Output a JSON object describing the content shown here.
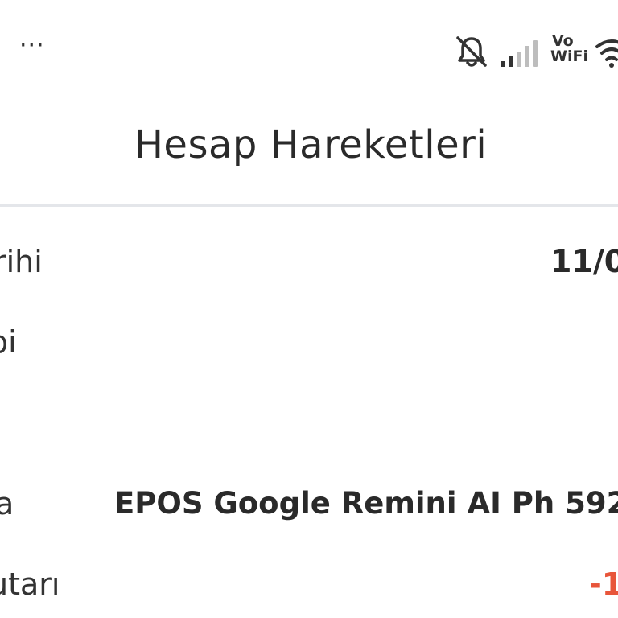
{
  "status_bar": {
    "more_label": "···",
    "vowifi_line1": "Vo",
    "vowifi_line2": "WiFi",
    "icons": [
      "bell-muted-icon",
      "signal-icon",
      "vowifi-icon",
      "wifi-icon"
    ]
  },
  "header": {
    "title": "Hesap Hareketleri"
  },
  "details": {
    "date_label": "rihi",
    "date_value": "11/0",
    "type_label": "bi",
    "description_label": "a",
    "description_value": "EPOS Google Remini AI Ph 592",
    "amount_label": "utarı",
    "amount_value": "-1"
  },
  "colors": {
    "negative_amount": "#e8553a",
    "divider": "#e4e6ea"
  }
}
